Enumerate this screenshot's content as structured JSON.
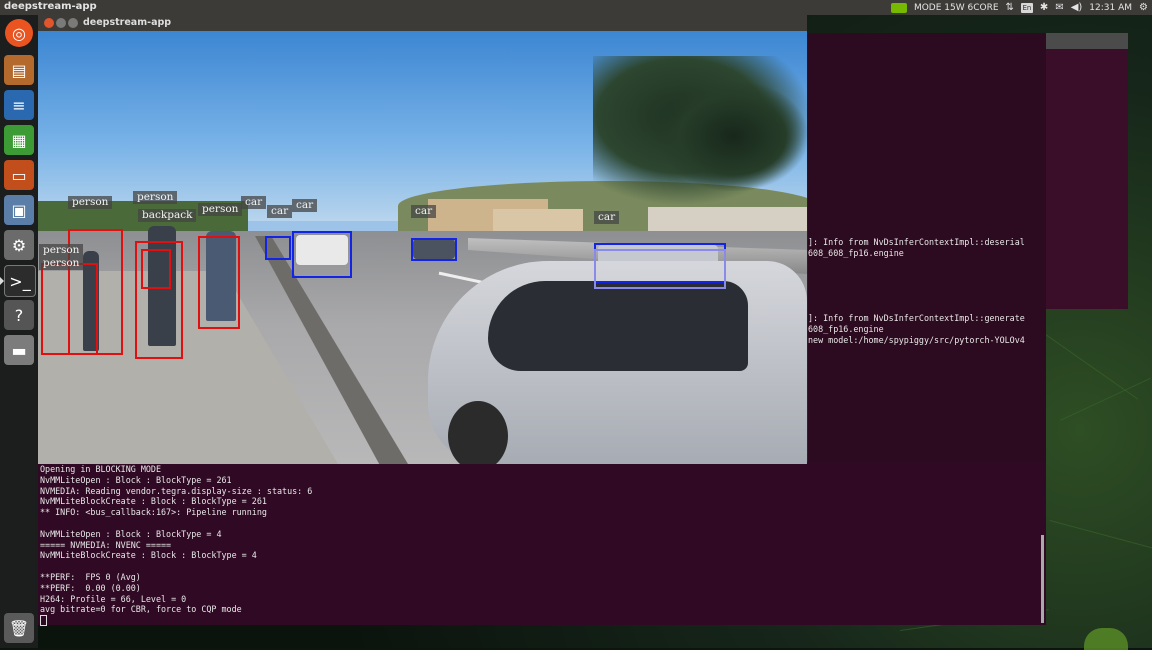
{
  "top_panel": {
    "app_name": "deepstream-app",
    "mode_label": "MODE 15W 6CORE",
    "keyboard_layout": "En",
    "time": "12:31 AM"
  },
  "launcher": {
    "items": [
      "ubuntu-dash",
      "files",
      "libreoffice-writer",
      "libreoffice-calc",
      "libreoffice-impress",
      "software-center",
      "system-settings",
      "terminal",
      "help",
      "drive",
      "trash"
    ]
  },
  "app_window": {
    "title": "deepstream-app",
    "detections": [
      {
        "label": "person",
        "color": "#e01010"
      },
      {
        "label": "person",
        "color": "#e01010"
      },
      {
        "label": "person",
        "color": "#e01010"
      },
      {
        "label": "person",
        "color": "#e01010"
      },
      {
        "label": "backpack",
        "color": "#e01010"
      },
      {
        "label": "car",
        "color": "#1424e6"
      },
      {
        "label": "car",
        "color": "#1424e6"
      },
      {
        "label": "car",
        "color": "#1424e6"
      },
      {
        "label": "car",
        "color": "#1424e6"
      },
      {
        "label": "car",
        "color": "#1424e6"
      },
      {
        "label": "car",
        "color": "#1424e6"
      }
    ],
    "tag_texts": {
      "person_a": "person",
      "person_b": "person",
      "person_c": "person",
      "person_d": "person",
      "person_e": "person",
      "backpack": "backpack",
      "car_a": "car",
      "car_b": "car",
      "car_c": "car",
      "car_d": "car",
      "car_e": "car"
    }
  },
  "terminal_main": {
    "lines": [
      "Opening in BLOCKING MODE",
      "NvMMLiteOpen : Block : BlockType = 261",
      "NVMEDIA: Reading vendor.tegra.display-size : status: 6",
      "NvMMLiteBlockCreate : Block : BlockType = 261",
      "** INFO: <bus_callback:167>: Pipeline running",
      "",
      "NvMMLiteOpen : Block : BlockType = 4",
      "===== NVMEDIA: NVENC =====",
      "NvMMLiteBlockCreate : Block : BlockType = 4",
      "",
      "**PERF:  FPS 0 (Avg)",
      "**PERF:  0.00 (0.00)",
      "H264: Profile = 66, Level = 0",
      "avg bitrate=0 for CBR, force to CQP mode"
    ]
  },
  "terminal_background": {
    "block1": [
      "]: Info from NvDsInferContextImpl::deserial",
      "608_608_fp16.engine"
    ],
    "block2": [
      "]: Info from NvDsInferContextImpl::generate",
      "608_fp16.engine",
      "new model:/home/spypiggy/src/pytorch-YOLOv4"
    ]
  }
}
